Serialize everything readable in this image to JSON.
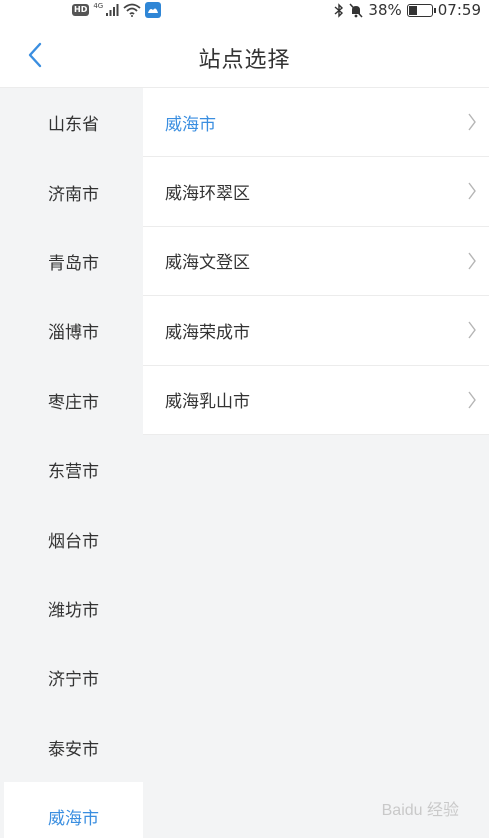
{
  "status_bar": {
    "hd_label": "HD",
    "network_label": "4G",
    "battery_text": "38%",
    "battery_level": 0.38,
    "time": "07:59"
  },
  "header": {
    "title": "站点选择"
  },
  "provinces": [
    {
      "label": "山东省"
    },
    {
      "label": "济南市"
    },
    {
      "label": "青岛市"
    },
    {
      "label": "淄博市"
    },
    {
      "label": "枣庄市"
    },
    {
      "label": "东营市"
    },
    {
      "label": "烟台市"
    },
    {
      "label": "潍坊市"
    },
    {
      "label": "济宁市"
    },
    {
      "label": "泰安市"
    },
    {
      "label": "威海市",
      "selected": true
    }
  ],
  "districts": [
    {
      "label": "威海市",
      "selected": true
    },
    {
      "label": "威海环翠区"
    },
    {
      "label": "威海文登区"
    },
    {
      "label": "威海荣成市"
    },
    {
      "label": "威海乳山市"
    }
  ],
  "accent_color": "#3a8ee0",
  "icons": {
    "back": "chevron-left-icon",
    "row_arrow": "chevron-right-icon"
  }
}
